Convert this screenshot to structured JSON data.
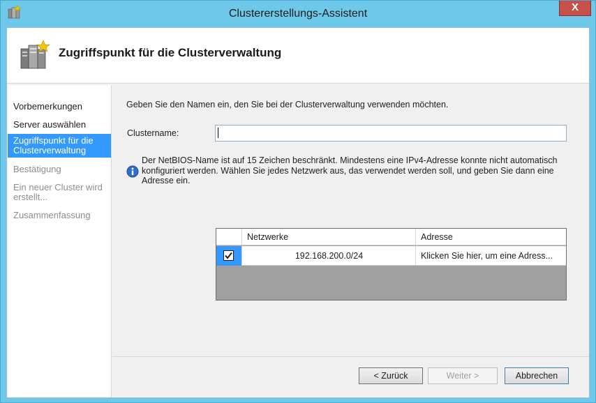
{
  "window": {
    "title": "Clustererstellungs-Assistent",
    "close_label": "X"
  },
  "header": {
    "title": "Zugriffspunkt für die Clusterverwaltung"
  },
  "sidebar": {
    "steps": [
      {
        "label": "Vorbemerkungen",
        "state": "normal"
      },
      {
        "label": "Server auswählen",
        "state": "normal"
      },
      {
        "label": "Zugriffspunkt für die Clusterverwaltung",
        "state": "active"
      },
      {
        "label": "Bestätigung",
        "state": "disabled"
      },
      {
        "label": "Ein neuer Cluster wird erstellt...",
        "state": "disabled"
      },
      {
        "label": "Zusammenfassung",
        "state": "disabled"
      }
    ]
  },
  "main": {
    "intro": "Geben Sie den Namen ein, den Sie bei der Clusterverwaltung verwenden möchten.",
    "clustername_label": "Clustername:",
    "clustername_value": "",
    "info_text": "Der NetBIOS-Name ist auf 15 Zeichen beschränkt.  Mindestens eine IPv4-Adresse konnte nicht automatisch konfiguriert werden. Wählen Sie jedes Netzwerk aus, das verwendet werden soll, und geben Sie dann eine Adresse ein.",
    "grid": {
      "columns": [
        "",
        "Netzwerke",
        "Adresse"
      ],
      "rows": [
        {
          "checked": true,
          "network": "192.168.200.0/24",
          "address": "Klicken Sie hier, um eine Adress..."
        }
      ]
    }
  },
  "footer": {
    "back_label": "< Zurück",
    "next_label": "Weiter >",
    "cancel_label": "Abbrechen"
  },
  "colors": {
    "titlebar": "#6dc8ea",
    "selection": "#3399ff",
    "close": "#c7514a"
  }
}
